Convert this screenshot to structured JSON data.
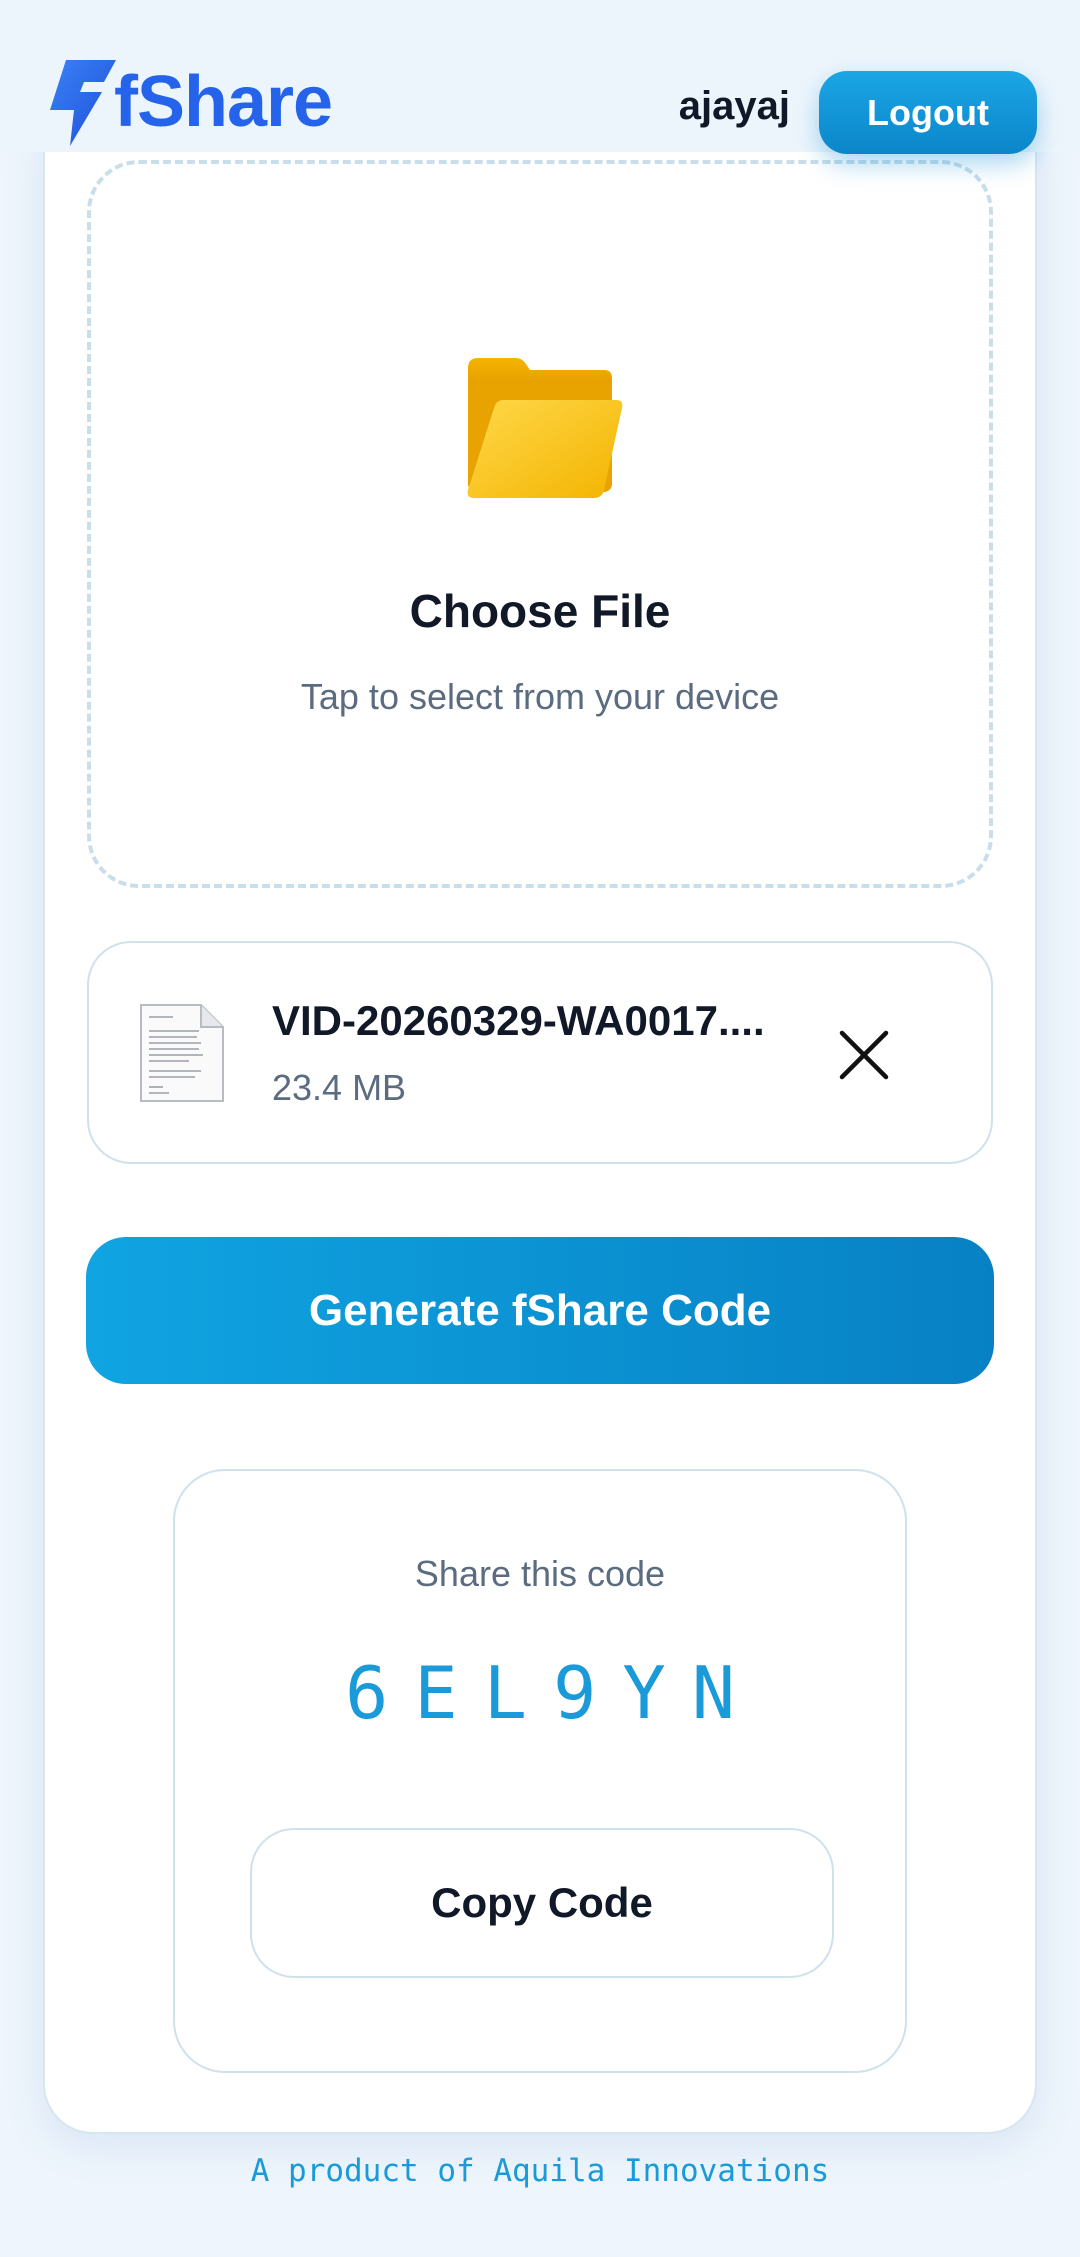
{
  "header": {
    "app_name": "fShare",
    "username": "ajayaj",
    "logout_label": "Logout"
  },
  "upload": {
    "title": "Choose File",
    "subtitle": "Tap to select from your device",
    "icon": "folder-icon"
  },
  "selected_file": {
    "name": "VID-20260329-WA0017....",
    "size": "23.4 MB",
    "icon": "document-icon",
    "remove_icon": "close-icon"
  },
  "actions": {
    "generate_label": "Generate fShare Code"
  },
  "share": {
    "label": "Share this code",
    "code": "6EL9YN",
    "copy_label": "Copy Code"
  },
  "footer": {
    "text": "A product of Aquila Innovations"
  },
  "colors": {
    "brand": "#2563eb",
    "accent": "#0e96d8",
    "code": "#1a9ad8"
  }
}
